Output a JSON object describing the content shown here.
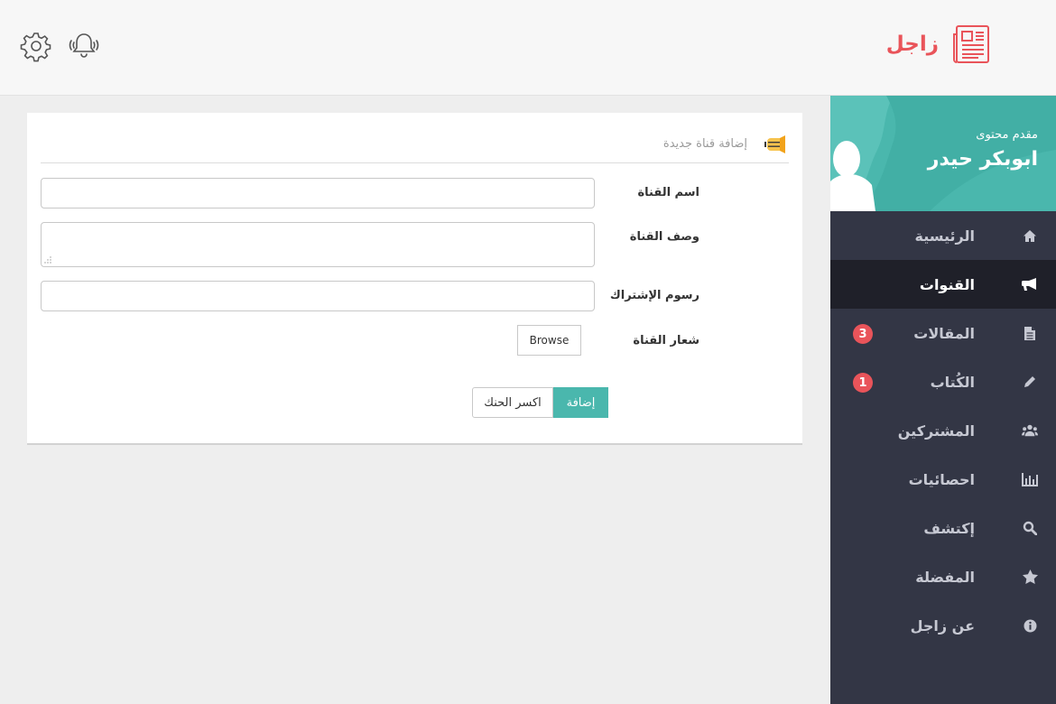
{
  "header": {
    "brand": "زاجل",
    "icons": {
      "logo": "newspaper-icon",
      "notifications": "bell-icon",
      "settings": "gear-icon"
    }
  },
  "sidebar": {
    "role": "مقدم محتوى",
    "user_name": "ابوبكر حيدر",
    "items": [
      {
        "label": "الرئيسية",
        "icon": "home-icon",
        "active": false
      },
      {
        "label": "القنوات",
        "icon": "bullhorn-icon",
        "active": true
      },
      {
        "label": "المقالات",
        "icon": "file-icon",
        "badge": "3",
        "active": false
      },
      {
        "label": "الكُتاب",
        "icon": "pencil-icon",
        "badge": "1",
        "active": false
      },
      {
        "label": "المشتركين",
        "icon": "users-icon",
        "active": false
      },
      {
        "label": "احصائيات",
        "icon": "bar-chart-icon",
        "active": false
      },
      {
        "label": "إكتشف",
        "icon": "search-icon",
        "active": false
      },
      {
        "label": "المفضلة",
        "icon": "star-icon",
        "active": false
      },
      {
        "label": "عن زاجل",
        "icon": "info-icon",
        "active": false
      }
    ]
  },
  "form": {
    "title": "إضافة قناة جديدة",
    "fields": {
      "name_label": "اسم القناة",
      "name_value": "",
      "desc_label": "وصف القناة",
      "desc_value": "",
      "fee_label": "رسوم الإشتراك",
      "fee_value": "",
      "logo_label": "شعار القناة"
    },
    "browse_label": "Browse",
    "submit_label": "إضافة",
    "cancel_label": "اكسر الحنك"
  },
  "colors": {
    "accent": "#4ab7ad",
    "brand": "#e9545a",
    "sidebar": "#333645",
    "sidebar_active": "#1f2029"
  }
}
